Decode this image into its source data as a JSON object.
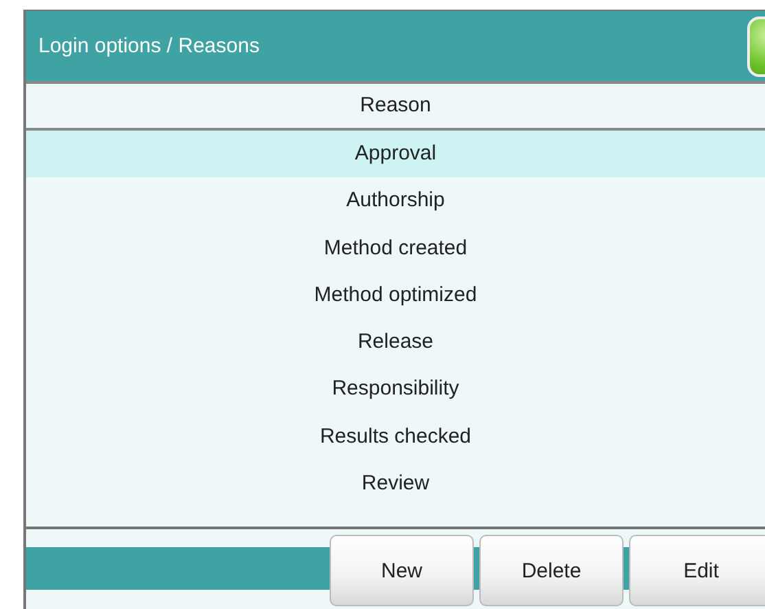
{
  "window": {
    "title": "Login options / Reasons"
  },
  "table": {
    "columns": [
      "Reason"
    ],
    "rows": [
      {
        "label": "Approval",
        "selected": true
      },
      {
        "label": "Authorship",
        "selected": false
      },
      {
        "label": "Method created",
        "selected": false
      },
      {
        "label": "Method optimized",
        "selected": false
      },
      {
        "label": "Release",
        "selected": false
      },
      {
        "label": "Responsibility",
        "selected": false
      },
      {
        "label": "Results checked",
        "selected": false
      },
      {
        "label": "Review",
        "selected": false
      }
    ]
  },
  "buttons": [
    "New",
    "Delete",
    "Edit"
  ]
}
